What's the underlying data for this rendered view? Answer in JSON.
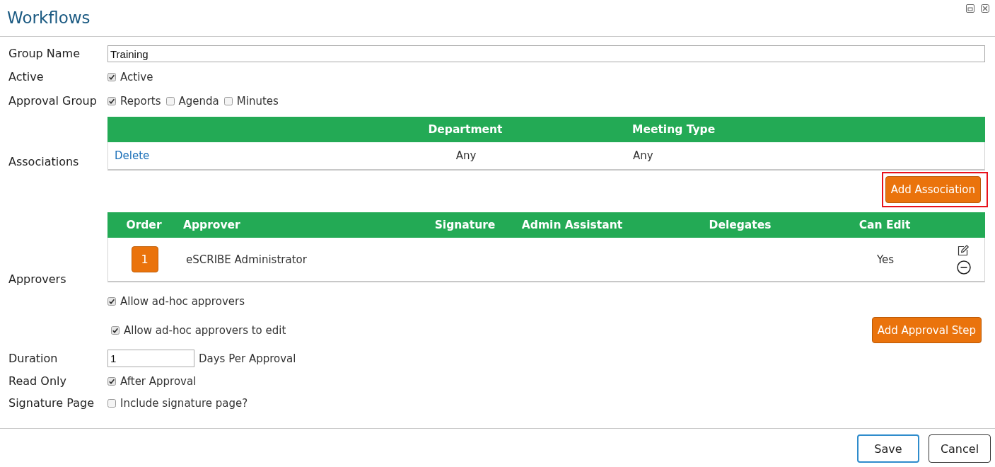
{
  "window": {
    "title": "Workflows"
  },
  "form": {
    "group_name": {
      "label": "Group Name",
      "value": "Training"
    },
    "active": {
      "label": "Active",
      "options": [
        {
          "label": "Active",
          "checked": true
        }
      ]
    },
    "approval_group": {
      "label": "Approval Group",
      "options": [
        {
          "label": "Reports",
          "checked": true
        },
        {
          "label": "Agenda",
          "checked": false
        },
        {
          "label": "Minutes",
          "checked": false
        }
      ]
    },
    "associations": {
      "label": "Associations",
      "columns": {
        "department": "Department",
        "meeting_type": "Meeting Type"
      },
      "rows": [
        {
          "action": "Delete",
          "department": "Any",
          "meeting_type": "Any"
        }
      ]
    },
    "add_association_button": {
      "label": "Add Association",
      "highlighted": true
    },
    "approvers": {
      "label": "Approvers",
      "columns": {
        "order": "Order",
        "approver": "Approver",
        "signature": "Signature",
        "admin_assistant": "Admin Assistant",
        "delegates": "Delegates",
        "can_edit": "Can Edit"
      },
      "rows": [
        {
          "order": "1",
          "approver": "eSCRIBE Administrator",
          "can_edit": "Yes"
        }
      ]
    },
    "ad_hoc_options": [
      {
        "label": "Allow ad-hoc approvers",
        "checked": true
      },
      {
        "label": "Allow ad-hoc approvers to edit",
        "checked": true
      }
    ],
    "add_approval_step_button": {
      "label": "Add Approval Step"
    },
    "duration": {
      "label": "Duration",
      "value": "1",
      "unit": "Days Per Approval"
    },
    "read_only": {
      "label": "Read Only",
      "options": [
        {
          "label": "After Approval",
          "checked": true
        }
      ]
    },
    "signature_page": {
      "label": "Signature Page",
      "options": [
        {
          "label": "Include signature page?",
          "checked": false
        }
      ]
    }
  },
  "footer": {
    "buttons": [
      {
        "label": "Save",
        "kind": "primary"
      },
      {
        "label": "Cancel",
        "kind": "secondary"
      }
    ]
  }
}
